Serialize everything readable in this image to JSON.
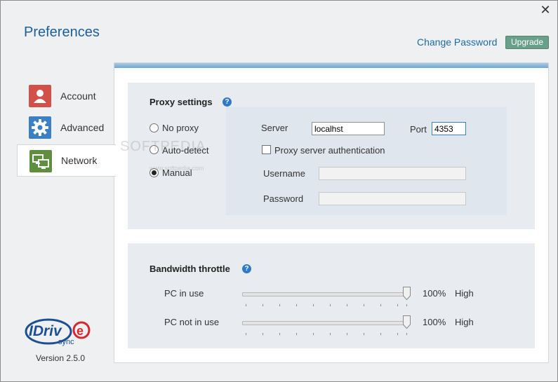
{
  "window": {
    "title": "Preferences",
    "close_glyph": "✕"
  },
  "header": {
    "change_password": "Change Password",
    "upgrade": "Upgrade"
  },
  "sidebar": {
    "items": [
      {
        "label": "Account",
        "icon": "account-icon",
        "color": "#d2504a"
      },
      {
        "label": "Advanced",
        "icon": "gear-icon",
        "color": "#3b7fc4"
      },
      {
        "label": "Network",
        "icon": "network-icon",
        "color": "#5f8f3e",
        "active": true
      }
    ],
    "logo_text": "IDrive",
    "logo_sub": "sync",
    "version": "Version 2.5.0"
  },
  "proxy": {
    "title": "Proxy settings",
    "options": [
      "No proxy",
      "Auto-detect",
      "Manual"
    ],
    "selected": "Manual",
    "server_label": "Server",
    "server_value": "localhst",
    "port_label": "Port",
    "port_value": "4353",
    "auth_label": "Proxy server authentication",
    "auth_checked": false,
    "username_label": "Username",
    "password_label": "Password",
    "username_value": "",
    "password_value": ""
  },
  "bandwidth": {
    "title": "Bandwidth throttle",
    "rows": [
      {
        "label": "PC in use",
        "percent": "100%",
        "level": "High",
        "value_fraction": 1.0
      },
      {
        "label": "PC not in use",
        "percent": "100%",
        "level": "High",
        "value_fraction": 1.0
      }
    ]
  },
  "watermark": {
    "main": "SOFTPEDIA",
    "small": "www.softpedia.com"
  },
  "colors": {
    "accent": "#1c5f9f",
    "upgrade_bg": "#6aa08a",
    "help_icon": "#2e7ac8"
  }
}
